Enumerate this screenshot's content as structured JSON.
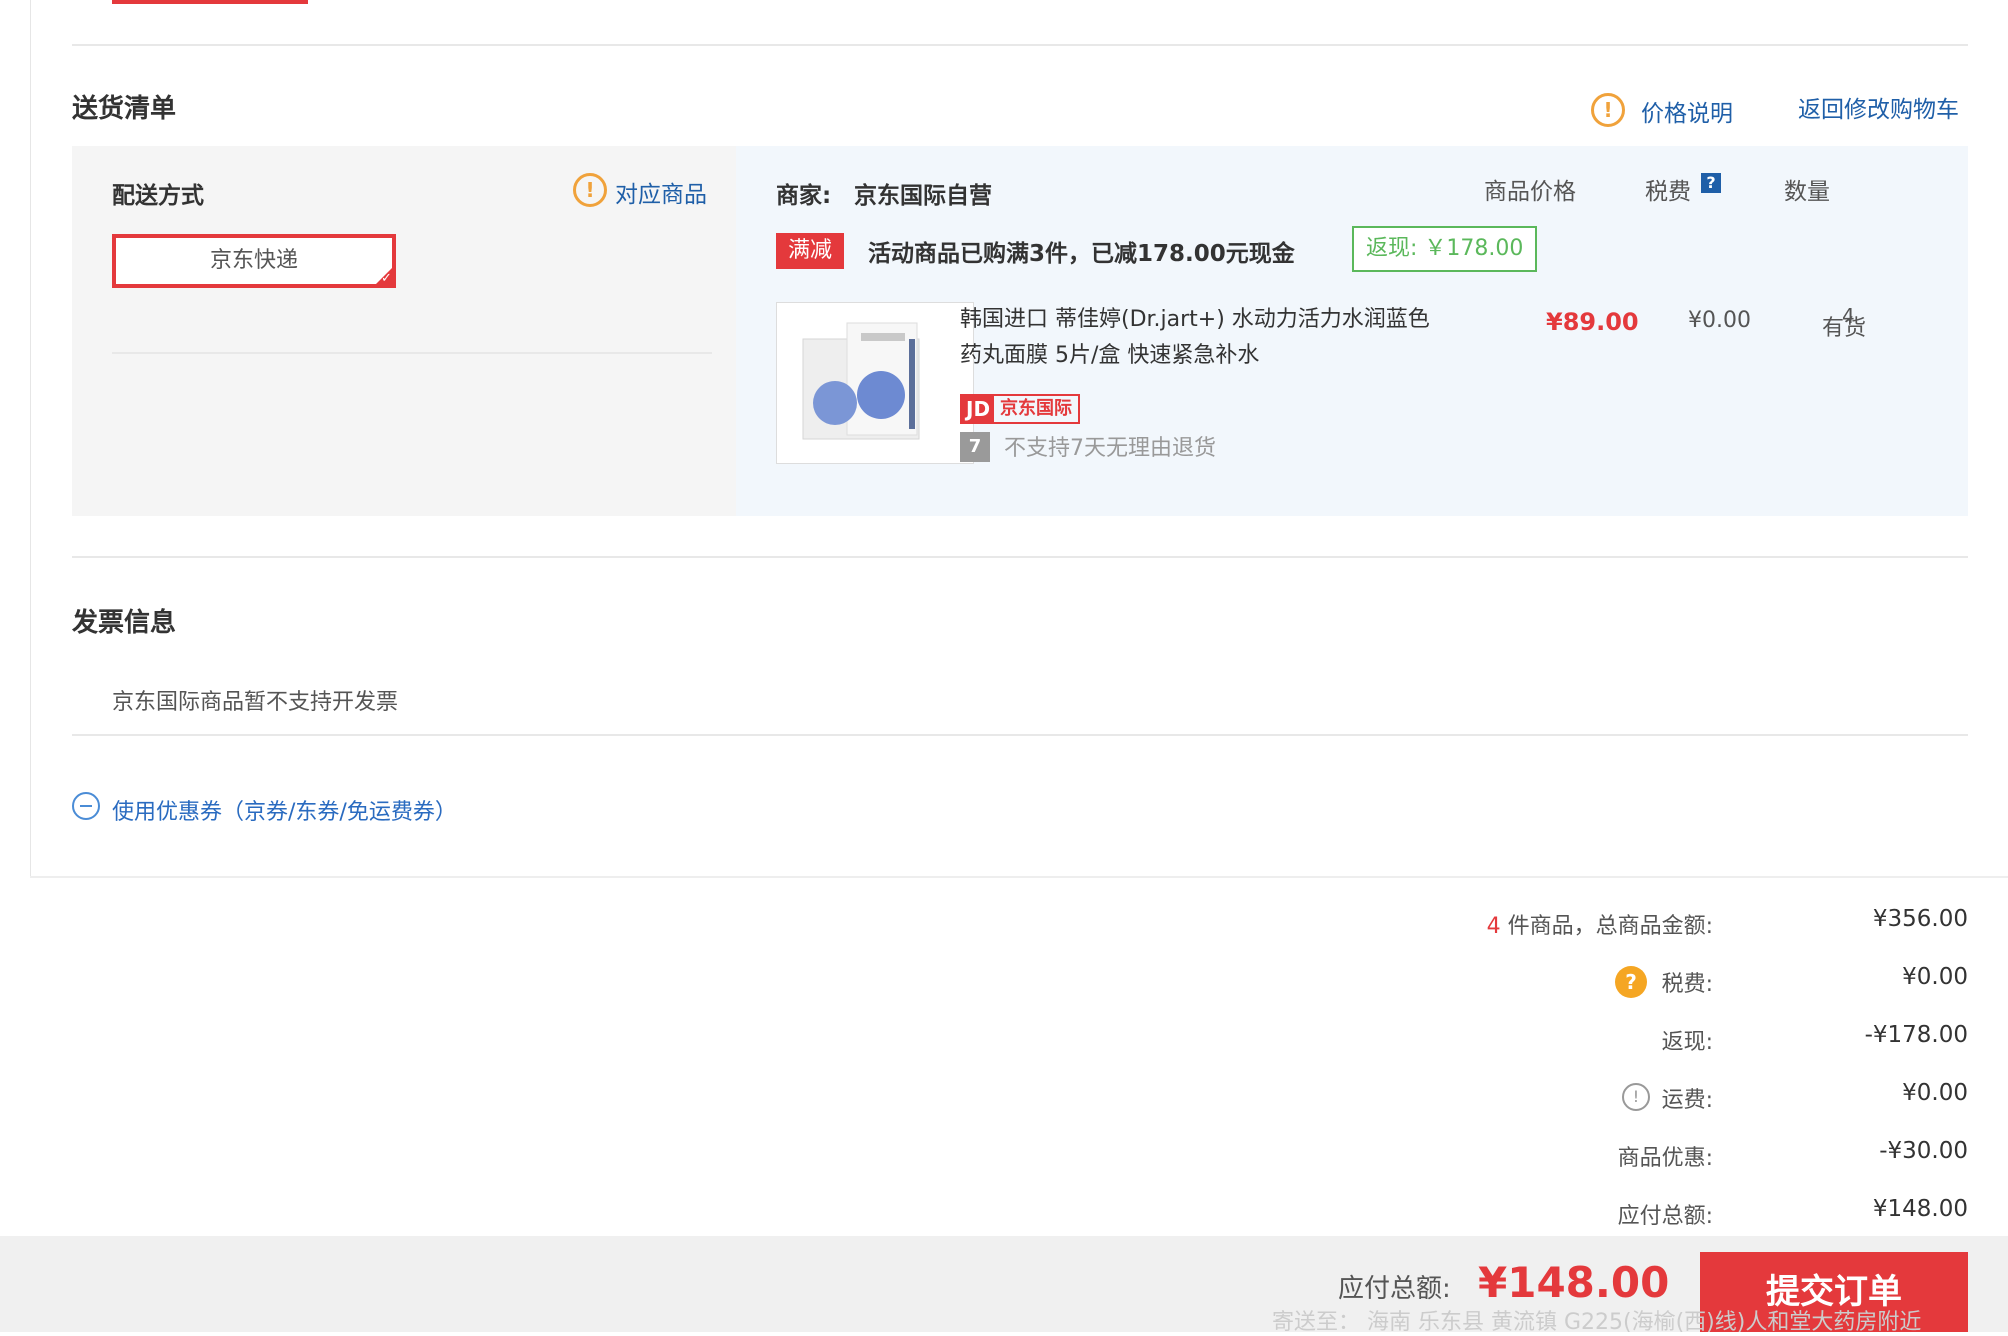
{
  "delivery": {
    "title": "送货清单",
    "price_note": "价格说明",
    "back_to_cart": "返回修改购物车",
    "method_label": "配送方式",
    "matched_goods": "对应商品",
    "express_option": "京东快递"
  },
  "goods": {
    "merchant_label": "商家:",
    "merchant_name": "京东国际自营",
    "col_price": "商品价格",
    "col_tax": "税费",
    "col_qty": "数量",
    "promo_tag": "满减",
    "promo_text": "活动商品已购满3件，已减178.00元现金",
    "rebate": "返现: ￥178.00",
    "product_name": "韩国进口 蒂佳婷(Dr.jart+) 水动力活力水润蓝色药丸面膜 5片/盒 快速紧急补水",
    "price": "¥89.00",
    "tax": "¥0.00",
    "qty": "有货",
    "qty_num": "4",
    "badge_jd": "JD",
    "badge_intl": "京东国际",
    "no_return": "不支持7天无理由退货"
  },
  "invoice": {
    "title": "发票信息",
    "text": "京东国际商品暂不支持开发票"
  },
  "coupon": {
    "label": "使用优惠券（京券/东券/免运费券）"
  },
  "summary": {
    "count": "4",
    "goods_total_label": " 件商品，总商品金额:",
    "goods_total": "¥356.00",
    "tax_label": "税费:",
    "tax": "¥0.00",
    "rebate_label": "返现:",
    "rebate": "-¥178.00",
    "shipping_label": "运费:",
    "shipping": "¥0.00",
    "discount_label": "商品优惠:",
    "discount": "-¥30.00",
    "payable_label": "应付总额:",
    "payable": "¥148.00"
  },
  "footer": {
    "total_label": "应付总额:",
    "total": "¥148.00",
    "submit": "提交订单",
    "ship_to": "寄送至： 海南 乐东县 黄流镇 G225(海榆(西)线)人和堂大药房附近"
  },
  "colors": {
    "accent_red": "#e4393c",
    "link_blue": "#1f5fa8",
    "rebate_green": "#5bb85b",
    "warn_orange": "#f0a23b"
  }
}
